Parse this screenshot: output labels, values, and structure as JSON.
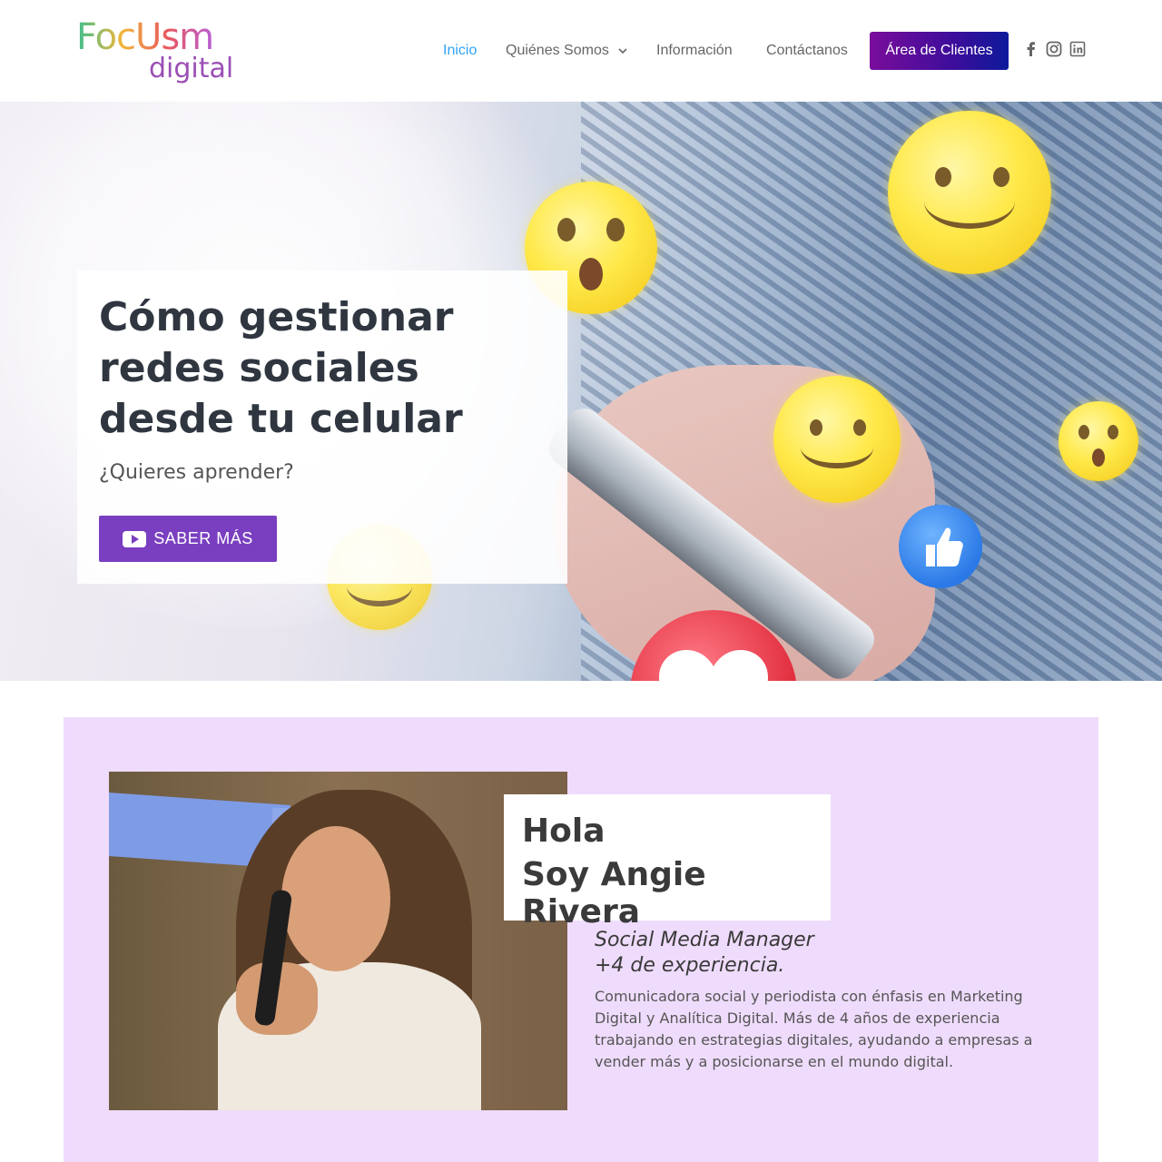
{
  "header": {
    "logo_top": "FocUsm",
    "logo_bottom": "digital",
    "nav": [
      {
        "label": "Inicio",
        "active": true
      },
      {
        "label": "Quiénes Somos",
        "has_dropdown": true
      },
      {
        "label": "Información"
      },
      {
        "label": "Contáctanos"
      }
    ],
    "cta_label": "Área de Clientes",
    "social_icons": [
      "facebook-icon",
      "instagram-icon",
      "linkedin-icon"
    ],
    "colors": {
      "active": "#2ea3f2",
      "cta_start": "#7a0d9b",
      "cta_end": "#0d1a9b"
    }
  },
  "hero": {
    "title": "Cómo gestionar redes sociales desde tu celular",
    "subtitle": "¿Quieres aprender?",
    "button_label": "SABER MÁS",
    "button_icon": "youtube-play-icon",
    "colors": {
      "button": "#7a3fc0"
    }
  },
  "about": {
    "greeting": "Hola",
    "name": "Soy Angie Rivera",
    "role_line1": "Social Media Manager",
    "role_line2": "+4 de experiencia.",
    "bio": "Comunicadora social y periodista con énfasis en Marketing Digital y Analítica Digital. Más de 4 años de experiencia trabajando en estrategias digitales, ayudando a empresas a vender más y a posicionarse en el mundo digital.",
    "colors": {
      "background": "#efdcfc"
    }
  }
}
